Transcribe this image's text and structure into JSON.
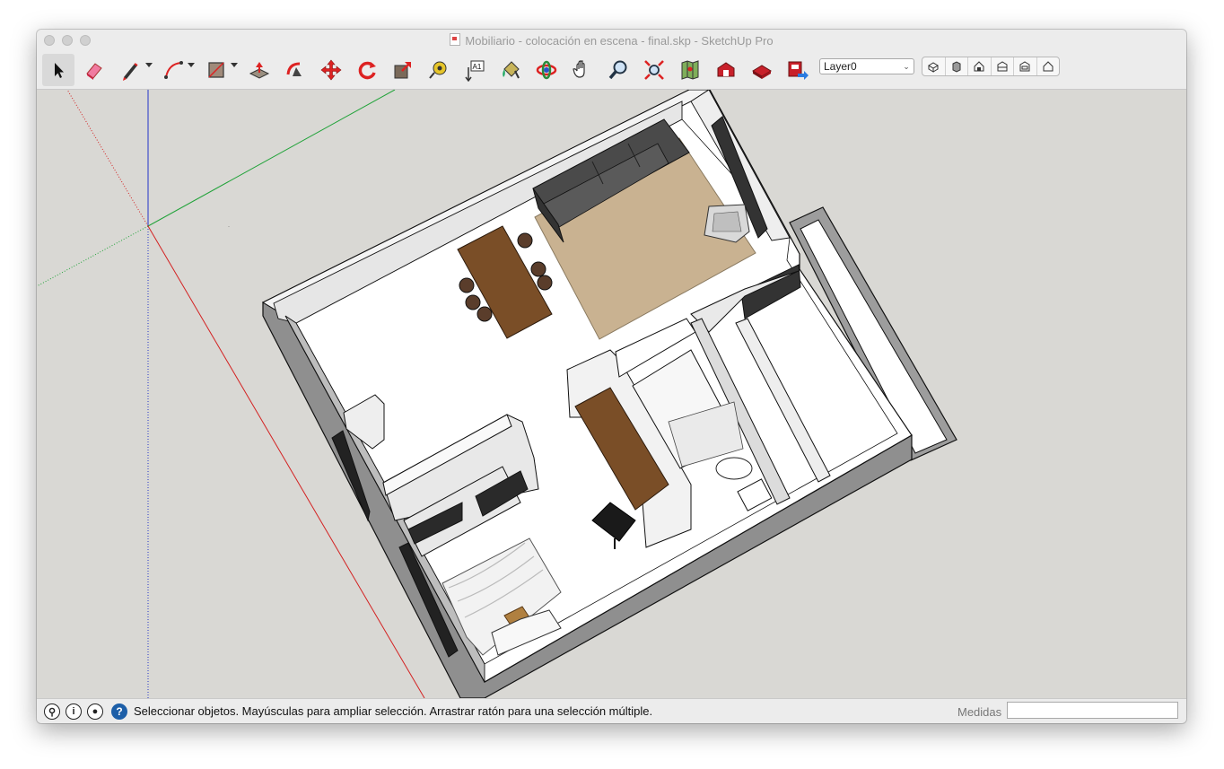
{
  "window": {
    "title": "Mobiliario - colocación en escena - final.skp - SketchUp Pro"
  },
  "toolbar": {
    "tools": [
      {
        "name": "select-tool",
        "icon": "arrow-cursor-icon"
      },
      {
        "name": "eraser-tool",
        "icon": "eraser-icon"
      },
      {
        "name": "line-tool",
        "icon": "pencil-icon"
      },
      {
        "name": "arc-tool",
        "icon": "arc-icon"
      },
      {
        "name": "rectangle-tool",
        "icon": "rectangle-icon"
      },
      {
        "name": "push-pull-tool",
        "icon": "push-pull-icon"
      },
      {
        "name": "follow-me-tool",
        "icon": "follow-me-icon"
      },
      {
        "name": "move-tool",
        "icon": "move-arrows-icon"
      },
      {
        "name": "rotate-tool",
        "icon": "rotate-icon"
      },
      {
        "name": "scale-tool",
        "icon": "scale-icon"
      },
      {
        "name": "tape-measure-tool",
        "icon": "tape-measure-icon"
      },
      {
        "name": "text-tool",
        "icon": "text-label-icon"
      },
      {
        "name": "paint-bucket-tool",
        "icon": "paint-bucket-icon"
      },
      {
        "name": "orbit-tool",
        "icon": "orbit-icon"
      },
      {
        "name": "pan-tool",
        "icon": "hand-icon"
      },
      {
        "name": "zoom-tool",
        "icon": "magnifier-icon"
      },
      {
        "name": "zoom-extents-tool",
        "icon": "zoom-extents-icon"
      },
      {
        "name": "add-location-tool",
        "icon": "map-icon"
      },
      {
        "name": "3d-warehouse-tool",
        "icon": "warehouse-icon"
      },
      {
        "name": "extension-warehouse-tool",
        "icon": "extension-icon"
      },
      {
        "name": "share-model-tool",
        "icon": "share-icon"
      }
    ],
    "text_tool_glyph": "A1",
    "layer": {
      "selected": "Layer0"
    },
    "views": [
      "iso-view-icon",
      "top-view-icon",
      "front-view-icon",
      "right-view-icon",
      "back-view-icon",
      "left-view-icon"
    ]
  },
  "colors": {
    "red_axis": "#d32222",
    "green_axis": "#22a33a",
    "blue_axis": "#2233c8",
    "viewport_bg": "#d9d8d4",
    "wood": "#7a4e27",
    "sofa": "#4a4a4a",
    "rug": "#c9b291"
  },
  "statusbar": {
    "message": "Seleccionar objetos. Mayúsculas para ampliar selección. Arrastrar ratón para una selección múltiple.",
    "measures_label": "Medidas",
    "measures_value": ""
  }
}
